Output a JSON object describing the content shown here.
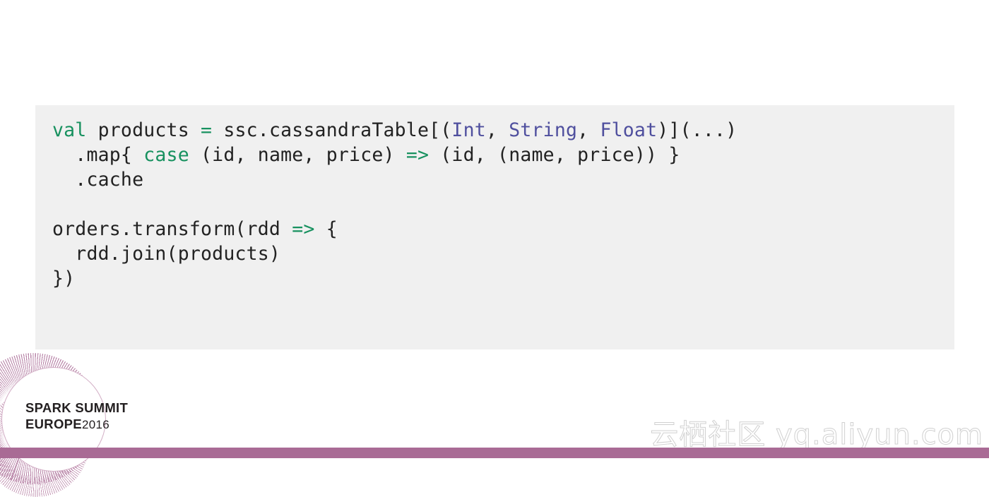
{
  "slide": {
    "background_color": "#ffffff",
    "code_block": {
      "background_color": "#f0f0f0",
      "language": "scala",
      "syntax_colors": {
        "keyword": "#17915f",
        "operator": "#17915f",
        "type": "#4f4f9e",
        "plain": "#222222"
      },
      "lines": [
        {
          "index": 0,
          "text": "val products = ssc.cassandraTable[(Int, String, Float)](...)",
          "tokens": [
            {
              "t": "val",
              "c": "kw"
            },
            {
              "t": " products ",
              "c": "plain"
            },
            {
              "t": "=",
              "c": "op"
            },
            {
              "t": " ssc.cassandraTable[(",
              "c": "plain"
            },
            {
              "t": "Int",
              "c": "type"
            },
            {
              "t": ", ",
              "c": "plain"
            },
            {
              "t": "String",
              "c": "type"
            },
            {
              "t": ", ",
              "c": "plain"
            },
            {
              "t": "Float",
              "c": "type"
            },
            {
              "t": ")](...)",
              "c": "plain"
            }
          ]
        },
        {
          "index": 1,
          "text": "  .map{ case (id, name, price) => (id, (name, price)) }",
          "tokens": [
            {
              "t": "  .map{ ",
              "c": "plain"
            },
            {
              "t": "case",
              "c": "kw"
            },
            {
              "t": " (id, name, price) ",
              "c": "plain"
            },
            {
              "t": "=>",
              "c": "op"
            },
            {
              "t": " (id, (name, price)) }",
              "c": "plain"
            }
          ]
        },
        {
          "index": 2,
          "text": "  .cache",
          "tokens": [
            {
              "t": "  .cache",
              "c": "plain"
            }
          ]
        },
        {
          "index": 3,
          "text": "",
          "tokens": [
            {
              "t": " ",
              "c": "plain"
            }
          ]
        },
        {
          "index": 4,
          "text": "orders.transform(rdd => {",
          "tokens": [
            {
              "t": "orders.transform(rdd ",
              "c": "plain"
            },
            {
              "t": "=>",
              "c": "op"
            },
            {
              "t": " {",
              "c": "plain"
            }
          ]
        },
        {
          "index": 5,
          "text": "  rdd.join(products)",
          "tokens": [
            {
              "t": "  rdd.join(products)",
              "c": "plain"
            }
          ]
        },
        {
          "index": 6,
          "text": "})",
          "tokens": [
            {
              "t": "})",
              "c": "plain"
            }
          ]
        }
      ]
    },
    "logo": {
      "line1": "SPARK SUMMIT",
      "line2_word": "EUROPE",
      "line2_year": "2016",
      "accent_color": "#a96b95"
    },
    "watermark": {
      "text": "云栖社区 yq.aliyun.com"
    },
    "bottom_bar": {
      "color": "#a96b95"
    }
  }
}
